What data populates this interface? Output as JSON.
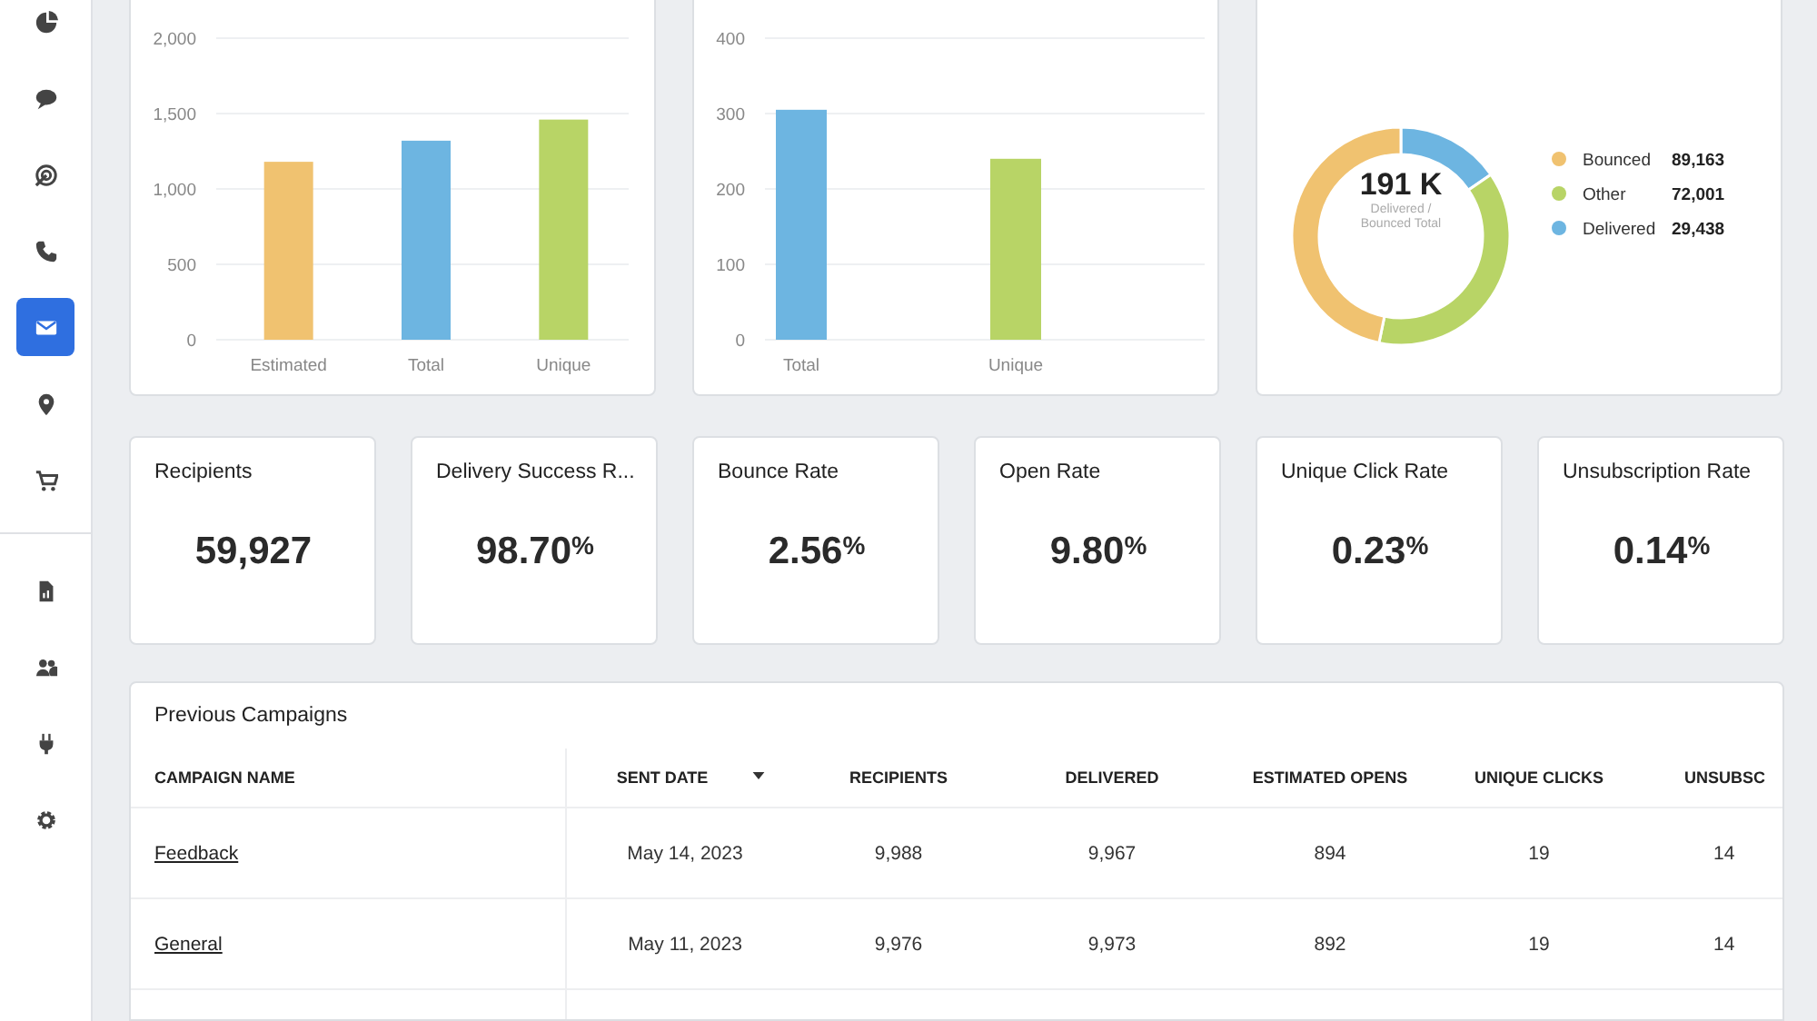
{
  "sidebar": {
    "groups": [
      [
        {
          "selected": false
        },
        {
          "selected": false
        },
        {
          "selected": false
        },
        {
          "selected": false
        },
        {
          "selected": true
        },
        {
          "selected": false
        },
        {
          "selected": false
        }
      ],
      [
        {
          "selected": false
        },
        {
          "selected": false
        },
        {
          "selected": false
        },
        {
          "selected": false
        }
      ]
    ]
  },
  "charts": [
    {
      "chart_data": {
        "type": "bar",
        "grid": true,
        "categories": [
          "Estimated",
          "Total",
          "Unique"
        ],
        "yticks": [
          0,
          {
            "value": 500,
            "label": "500"
          },
          {
            "value": 1000,
            "label": "1,000"
          },
          {
            "value": 1500,
            "label": "1,500"
          },
          {
            "value": 2000,
            "label": "2,000"
          }
        ],
        "ylim": [
          0,
          2000
        ],
        "values": [
          1180,
          1320,
          1460
        ],
        "colors": [
          "#f0c270",
          "#6db5e1",
          "#b8d466"
        ]
      }
    },
    {
      "chart_data": {
        "type": "bar",
        "grid": true,
        "categories": [
          "Total",
          "Unique"
        ],
        "yticks": [
          0,
          100,
          200,
          300,
          400
        ],
        "ylim": [
          0,
          400
        ],
        "values": [
          305,
          240
        ],
        "colors": [
          "#6db5e1",
          "#b8d466"
        ]
      }
    },
    {
      "center_value": "191 K",
      "center_caption": "Delivered / Bounced Total",
      "chart_data": {
        "type": "donut",
        "legend": true,
        "categories": [
          "Bounced",
          "Other",
          "Delivered"
        ],
        "values": [
          89163,
          72001,
          29438
        ],
        "colors": [
          "#f0c270",
          "#b8d466",
          "#6db5e1"
        ],
        "value_labels": [
          "89,163",
          "72,001",
          "29,438"
        ]
      }
    }
  ],
  "stats": [
    {
      "label": "Recipients",
      "value": "59,927"
    },
    {
      "label": "Delivery Success R...",
      "value": "98.70$^{%}$"
    },
    {
      "label": "Bounce Rate",
      "value": "2.56$^{%}$"
    },
    {
      "label": "Open Rate",
      "value": "9.80$^{%}$"
    },
    {
      "label": "Unique Click Rate",
      "value": "0.23$^{%}$"
    },
    {
      "label": "Unsubscription Rate",
      "value": "0.14$^{%}$"
    }
  ],
  "table": {
    "title": "Previous Campaigns",
    "columns": [
      {
        "label": "CAMPAIGN NAME",
        "sorted": false
      },
      {
        "label": "SENT DATE",
        "sorted": true
      },
      {
        "label": "RECIPIENTS",
        "sorted": false
      },
      {
        "label": "DELIVERED",
        "sorted": false
      },
      {
        "label": "ESTIMATED OPENS",
        "sorted": false
      },
      {
        "label": "UNIQUE CLICKS",
        "sorted": false
      },
      {
        "label": "UNSUBSC",
        "sorted": false
      }
    ],
    "rows": [
      [
        "Feedback",
        "May 14, 2023",
        "9,988",
        "9,967",
        "894",
        "19",
        "14"
      ],
      [
        "General",
        "May 11, 2023",
        "9,976",
        "9,973",
        "892",
        "19",
        "14"
      ]
    ]
  }
}
